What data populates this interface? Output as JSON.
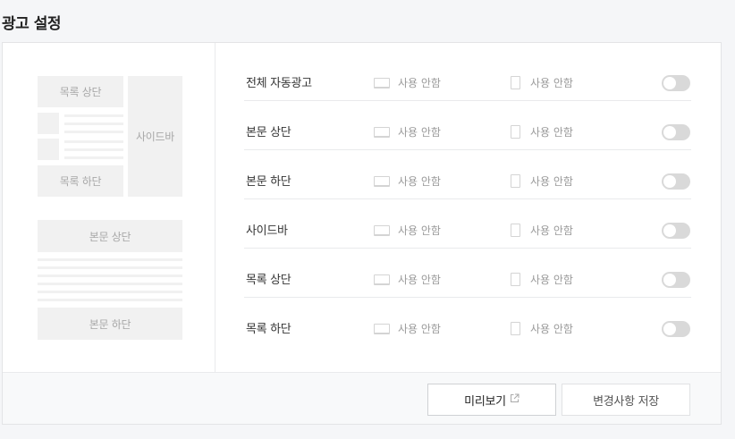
{
  "page": {
    "title": "광고 설정"
  },
  "preview": {
    "list_top": "목록 상단",
    "list_bottom": "목록 하단",
    "sidebar": "사이드바",
    "body_top": "본문 상단",
    "body_bottom": "본문 하단"
  },
  "settings": {
    "rows": [
      {
        "label": "전체 자동광고",
        "pc": "사용 안함",
        "mobile": "사용 안함",
        "enabled": false
      },
      {
        "label": "본문 상단",
        "pc": "사용 안함",
        "mobile": "사용 안함",
        "enabled": false
      },
      {
        "label": "본문 하단",
        "pc": "사용 안함",
        "mobile": "사용 안함",
        "enabled": false
      },
      {
        "label": "사이드바",
        "pc": "사용 안함",
        "mobile": "사용 안함",
        "enabled": false
      },
      {
        "label": "목록 상단",
        "pc": "사용 안함",
        "mobile": "사용 안함",
        "enabled": false
      },
      {
        "label": "목록 하단",
        "pc": "사용 안함",
        "mobile": "사용 안함",
        "enabled": false
      }
    ]
  },
  "icons": {
    "pc": "monitor-icon",
    "mobile": "mobile-icon",
    "external": "external-link-icon"
  },
  "footer": {
    "preview_button": "미리보기",
    "save_button": "변경사항 저장"
  }
}
